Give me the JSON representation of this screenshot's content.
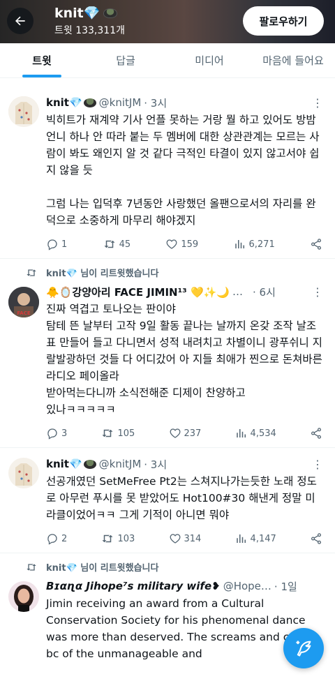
{
  "header": {
    "title": "knit💎",
    "tweet_count": "트윗 133,311개",
    "follow_label": "팔로우하기"
  },
  "tabs": [
    "트윗",
    "답글",
    "미디어",
    "마음에 들어요"
  ],
  "feed": [
    {
      "name": "knit💎",
      "handle": "@knitJM",
      "time": "· 3시",
      "text": "빅히트가 재계약 기사 언플 못하는 거랑 뭘 하고 있어도 방밤언니 하나 안 따라 붙는 두 멤버에 대한 상관관계는 모르는 사람이 봐도 왜인지 알 것 같다 극적인 타결이 있지 않고서야 쉽지 않을 듯\n\n그럼 나는 입덕후 7년동안 사랑했던 올팬으로서의 자리를 완덕으로 소중하게 마무리 해야겠지",
      "replies": "1",
      "retweets": "45",
      "likes": "159",
      "views": "6,271"
    },
    {
      "retweet_label": "knit💎 님이 리트윗했습니다",
      "name": "🐥🪞강양아리 FACE JIMIN¹³ 💛✨🌙",
      "handle": "…",
      "time": "· 6시",
      "text": "진짜 역겹고 토나오는 판이야\n탐테 뜬 날부터 고작 9일 활동 끝나는 날까지 온갖 조작 날조표 만들어 들고 다니면서 성적 내려치고 차별이니 광푸쉬니 지랄발광하던 것들 다 어디갔어 아 지들 최애가 찐으로 돈쳐바른 라디오 페이올라\n받아먹는다니까 소식전해준 디제이 찬양하고\n있나ㅋㅋㅋㅋㅋ",
      "replies": "3",
      "retweets": "105",
      "likes": "237",
      "views": "4,534"
    },
    {
      "name": "knit💎",
      "handle": "@knitJM",
      "time": "· 3시",
      "text": "선공개였던 SetMeFree Pt2는 스쳐지나가는듯한 노래 정도로 아무런 푸시를 못 받았어도 Hot100#30 해낸게 정말 미라클이었어ㅋㅋ 그게 기적이 아니면 뭐야",
      "replies": "2",
      "retweets": "103",
      "likes": "314",
      "views": "4,147"
    },
    {
      "retweet_label": "knit💎 님이 리트윗했습니다",
      "name": "Bɪαɳα Jihope⁷s military wife❥",
      "handle": "@Hope…",
      "time": "· 1일",
      "text": "Jimin receiving an award from a Cultural Conservation Society for his phenomenal dance was more than deserved. The screams and cries bc of the unmanageable and"
    }
  ],
  "colors": {
    "accent": "#1d9bf0",
    "text": "#0f1419",
    "muted": "#536471",
    "border": "#eff3f4"
  }
}
